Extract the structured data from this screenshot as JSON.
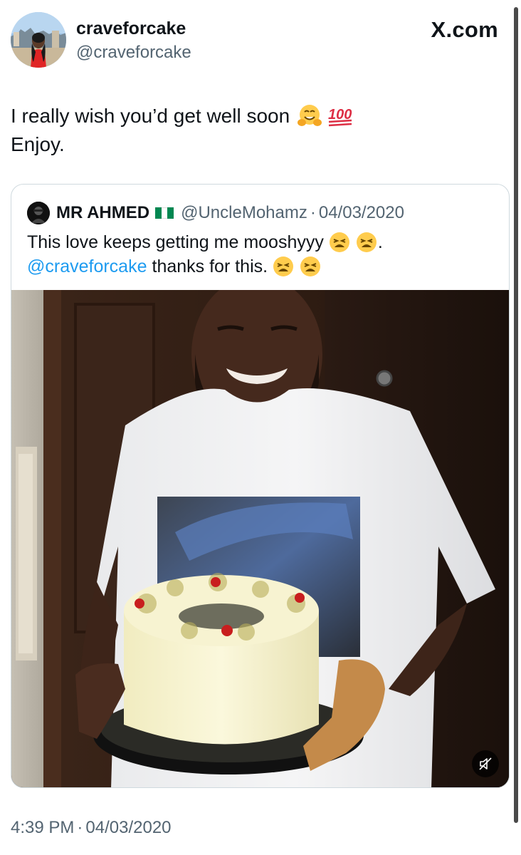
{
  "header": {
    "display_name": "craveforcake",
    "handle": "@craveforcake",
    "brand": "X.com"
  },
  "tweet": {
    "line1": "I really wish you’d get well soon",
    "line1_emojis": [
      "hugging-face",
      "hundred-points"
    ],
    "line2": "Enjoy."
  },
  "quote": {
    "display_name": "MR AHMED",
    "flag": "nigeria-flag",
    "handle": "@UncleMohamz",
    "separator": "·",
    "date": "04/03/2020",
    "line1": "This love keeps getting me mooshyyy",
    "line1_emojis": [
      "weary-face",
      "weary-face"
    ],
    "line1_end": ".",
    "line2_mention": "@craveforcake",
    "line2": "thanks for this.",
    "line2_emojis": [
      "weary-face",
      "weary-face"
    ],
    "media": {
      "kind": "video",
      "description_icon": "video-thumbnail",
      "mute_icon": "speaker-muted-icon"
    }
  },
  "footer": {
    "time": "4:39 PM",
    "separator": "·",
    "date": "04/03/2020"
  },
  "colors": {
    "text": "#0f1419",
    "secondary": "#536471",
    "link": "#1d9bf0",
    "border": "#cfd9de"
  }
}
